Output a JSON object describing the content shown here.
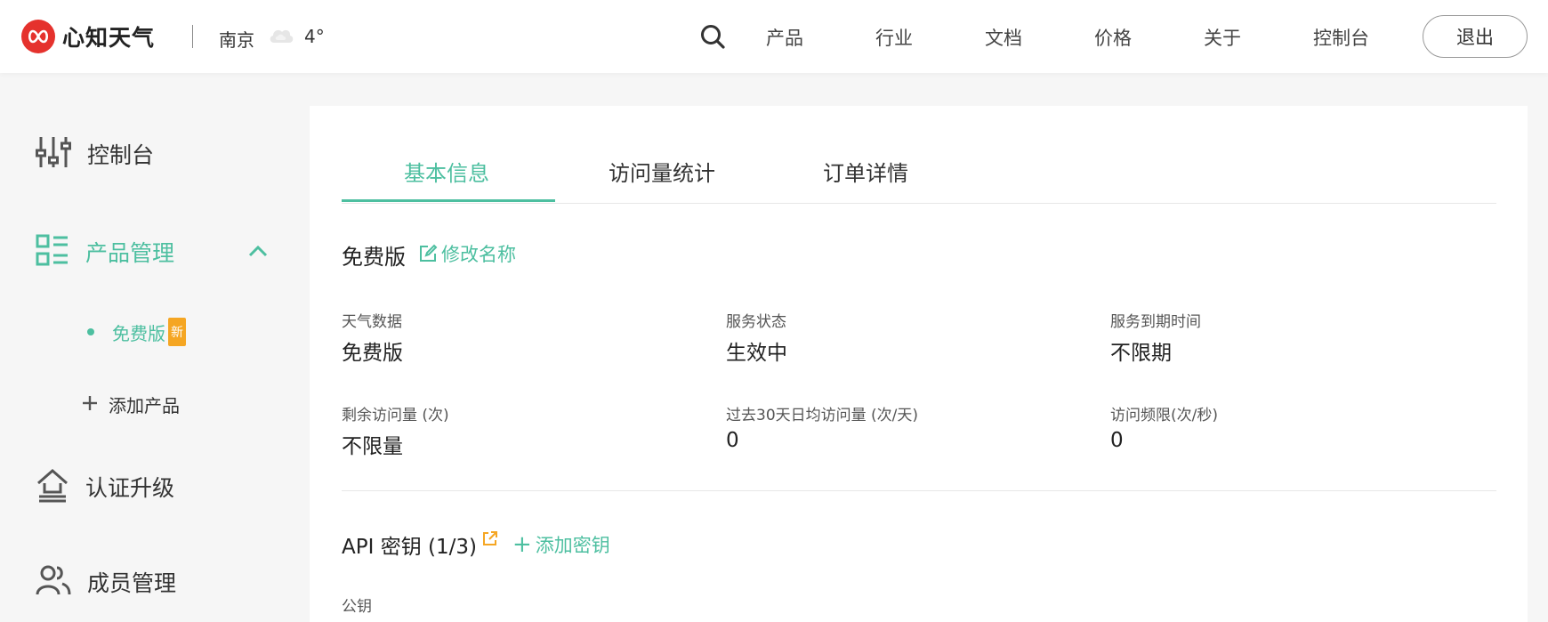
{
  "header": {
    "brand": "心知天气",
    "city": "南京",
    "weather_icon": "cloudy-icon",
    "temperature": "4°",
    "nav": [
      "产品",
      "行业",
      "文档",
      "价格",
      "关于",
      "控制台"
    ],
    "logout": "退出"
  },
  "sidebar": {
    "console": "控制台",
    "product_mgmt": "产品管理",
    "free_plan": "免费版",
    "new_badge": "新",
    "add_product": "添加产品",
    "auth_upgrade": "认证升级",
    "member_mgmt": "成员管理"
  },
  "tabs": [
    "基本信息",
    "访问量统计",
    "订单详情"
  ],
  "plan": {
    "name": "免费版",
    "rename": "修改名称"
  },
  "fields": [
    {
      "label": "天气数据",
      "value": "免费版"
    },
    {
      "label": "服务状态",
      "value": "生效中"
    },
    {
      "label": "服务到期时间",
      "value": "不限期"
    },
    {
      "label": "剩余访问量 (次)",
      "value": "不限量"
    },
    {
      "label": "过去30天日均访问量 (次/天)",
      "value": "0"
    },
    {
      "label": "访问频限(次/秒)",
      "value": "0"
    }
  ],
  "api": {
    "title": "API 密钥 (1/3)",
    "add_key": "添加密钥",
    "public_key_label": "公钥"
  },
  "colors": {
    "accent": "#4dbfa0",
    "brand_red": "#e5322d",
    "badge": "#f5a623"
  }
}
